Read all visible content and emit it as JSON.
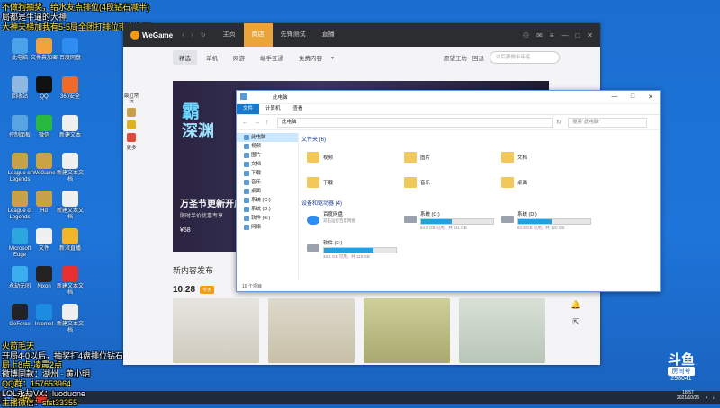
{
  "stream_overlay": {
    "top_lines": [
      "不做狗抽奖，给水友点排位(4段钻石减半)",
      "局都是牛逼的大神",
      "大神天梯加我有5-5局全团打排位带会钻石"
    ],
    "bottom_lines": [
      "火箭毛天",
      "开局4-0以后，抽奖打4盘排位钻石减半",
      "局上8点-凌晨2点",
      "微博同款：湖州 · 黄小明",
      "QQ群：157653964",
      "LOL永劫VX：luoduone",
      "主播微信：sfst33355"
    ]
  },
  "desktop": {
    "icons": [
      {
        "label": "此电脑",
        "color": "#4aa3e8"
      },
      {
        "label": "文件夹加密",
        "color": "#f3a33b"
      },
      {
        "label": "百度网盘",
        "color": "#2f8cf0"
      },
      {
        "label": "回收站",
        "color": "#8fb8e0"
      },
      {
        "label": "QQ",
        "color": "#111"
      },
      {
        "label": "360安全",
        "color": "#f06a2a"
      },
      {
        "label": "控制面板",
        "color": "#58a4e2"
      },
      {
        "label": "微信",
        "color": "#2ab940"
      },
      {
        "label": "新建文本",
        "color": "#f0f0f0"
      },
      {
        "label": "League of Legends",
        "color": "#c8a24a"
      },
      {
        "label": "WeGame",
        "color": "#caa344"
      },
      {
        "label": "新建文本文档",
        "color": "#f0f0f0"
      },
      {
        "label": "League of Legends",
        "color": "#c8a24a"
      },
      {
        "label": "Hd",
        "color": "#c8a24a"
      },
      {
        "label": "新建文本文档",
        "color": "#f0f0f0"
      },
      {
        "label": "Microsoft Edge",
        "color": "#2da6e0"
      },
      {
        "label": "文件",
        "color": "#f0f0f0"
      },
      {
        "label": "新浪直播",
        "color": "#f3b62b"
      },
      {
        "label": "永劫无间",
        "color": "#3caef0"
      },
      {
        "label": "Nixon",
        "color": "#222"
      },
      {
        "label": "新建文本文档",
        "color": "#e83030"
      },
      {
        "label": "GeForce",
        "color": "#222"
      },
      {
        "label": "Internet",
        "color": "#1c8ce0"
      },
      {
        "label": "新建文本文档",
        "color": "#f0f0f0"
      }
    ]
  },
  "wegame": {
    "logo": "WeGame",
    "nav": [
      {
        "label": "主页",
        "active": false
      },
      {
        "label": "商店",
        "active": true
      },
      {
        "label": "先锋测试",
        "active": false
      },
      {
        "label": "直播",
        "active": false
      }
    ],
    "subnav": [
      {
        "label": "精选",
        "active": true
      },
      {
        "label": "单机",
        "active": false
      },
      {
        "label": "网游",
        "active": false
      },
      {
        "label": "端手互通",
        "active": false
      },
      {
        "label": "免费内容",
        "active": false
      }
    ],
    "tools": {
      "a": "愿望工坊",
      "b": "回退"
    },
    "search_placeholder": "以后要做半年毛",
    "side": [
      {
        "label": "最近常玩"
      },
      {
        "label": "更多"
      }
    ],
    "banner": {
      "title1": "霸",
      "title2": "深渊",
      "headline": "万圣节更新开启",
      "subtitle": "限时半价优惠专享",
      "price": "¥58"
    },
    "section_title": "新内容发布",
    "date": "10.28",
    "date_badge": "今天"
  },
  "explorer": {
    "title": "此电脑",
    "ribbon": [
      {
        "label": "文件",
        "active": true
      },
      {
        "label": "计算机",
        "active": false
      },
      {
        "label": "查看",
        "active": false
      }
    ],
    "path": "此电脑",
    "search_placeholder": "搜索\"此电脑\"",
    "nav_items": [
      {
        "label": "此电脑",
        "active": true
      },
      {
        "label": "视频",
        "active": false
      },
      {
        "label": "图片",
        "active": false
      },
      {
        "label": "文档",
        "active": false
      },
      {
        "label": "下载",
        "active": false
      },
      {
        "label": "音乐",
        "active": false
      },
      {
        "label": "桌面",
        "active": false
      },
      {
        "label": "系统 (C:)",
        "active": false
      },
      {
        "label": "系统 (D:)",
        "active": false
      },
      {
        "label": "软件 (E:)",
        "active": false
      },
      {
        "label": "网络",
        "active": false
      }
    ],
    "folders_header": "文件夹 (6)",
    "folders": [
      "视频",
      "图片",
      "文档",
      "下载",
      "音乐",
      "桌面"
    ],
    "devices_header": "设备和驱动器 (4)",
    "devices": [
      {
        "name": "百度网盘",
        "sub": "双击运行百度网盘",
        "fill": null
      },
      {
        "name": "系统 (C:)",
        "sub": "64.0 GB 可用，共 111 GB",
        "fill": 0.42
      },
      {
        "name": "系统 (D:)",
        "sub": "64.8 GB 可用，共 120 GB",
        "fill": 0.46
      },
      {
        "name": "软件 (E:)",
        "sub": "36.1 GB 可用，共 118 GB",
        "fill": 0.69
      }
    ],
    "status": "10 个项目"
  },
  "douyu": {
    "logo": "斗鱼",
    "room_label": "房间号",
    "room_id": "298041"
  },
  "clock": {
    "time": "18:57",
    "date": "2021/10/26"
  }
}
